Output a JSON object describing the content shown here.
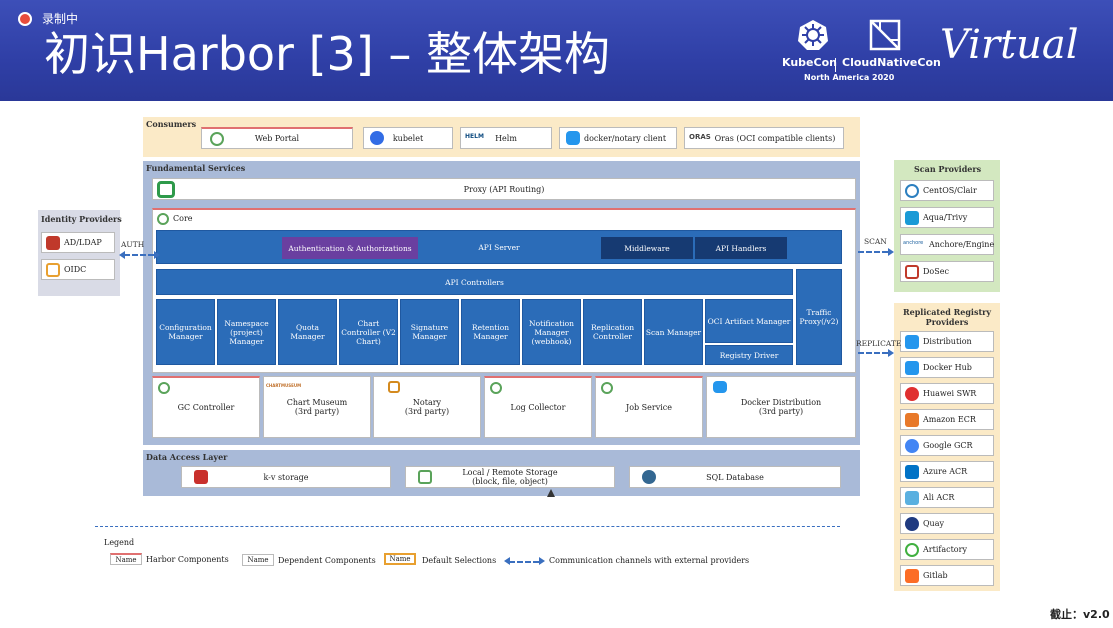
{
  "recording": {
    "label": "录制中"
  },
  "slide": {
    "title": "初识Harbor [3] – 整体架构"
  },
  "branding": {
    "kubecon": "KubeCon",
    "cloudnativecon": "CloudNativeCon",
    "event": "North America 2020",
    "virtual": "Virtual"
  },
  "consumers": {
    "title": "Consumers",
    "items": [
      "Web Portal",
      "kubelet",
      "Helm",
      "docker/notary client",
      "Oras (OCI compatible clients)"
    ],
    "helm_icon_text": "HELM",
    "oras_icon_text": "ORAS"
  },
  "fundamental": {
    "title": "Fundamental Services",
    "proxy": "Proxy (API Routing)",
    "core": "Core",
    "auth": "Authentication & Authorizations",
    "api_server": "API Server",
    "middleware": "Middleware",
    "api_handlers": "API Handlers",
    "api_controllers": "API Controllers",
    "controllers": [
      "Configuration Manager",
      "Namespace (project) Manager",
      "Quota Manager",
      "Chart Controller (V2 Chart)",
      "Signature Manager",
      "Retention Manager",
      "Notification Manager (webhook)",
      "Replication Controller",
      "Scan Manager"
    ],
    "oci_artifact": "OCI Artifact Manager",
    "registry_driver": "Registry Driver",
    "traffic_proxy": "Traffic Proxy(/v2)",
    "gc_controller": "GC Controller",
    "chart_museum": "Chart Museum",
    "chart_museum_sub": "(3rd party)",
    "chartmuseum_logo": "CHARTMUSEUM",
    "notary": "Notary",
    "notary_sub": "(3rd party)",
    "log_collector": "Log Collector",
    "job_service": "Job Service",
    "docker_distribution": "Docker Distribution",
    "docker_distribution_sub": "(3rd party)"
  },
  "data_access": {
    "title": "Data Access Layer",
    "kv": "k-v storage",
    "storage": "Local / Remote Storage",
    "storage_sub": "(block, file, object)",
    "sql": "SQL Database"
  },
  "identity": {
    "title": "Identity Providers",
    "items": [
      "AD/LDAP",
      "OIDC"
    ],
    "auth_label": "AUTH"
  },
  "scan": {
    "title": "Scan Providers",
    "items": [
      "CentOS/Clair",
      "Aqua/Trivy",
      "Anchore/Engine",
      "DoSec"
    ],
    "label": "SCAN",
    "anchore_icon_text": "anchore"
  },
  "replication": {
    "title": "Replicated Registry Providers",
    "items": [
      "Distribution",
      "Docker Hub",
      "Huawei SWR",
      "Amazon ECR",
      "Google GCR",
      "Azure ACR",
      "Ali ACR",
      "Quay",
      "Artifactory",
      "Gitlab"
    ],
    "label": "REPLICATE"
  },
  "legend": {
    "title": "Legend",
    "box_label": "Name",
    "harbor": "Harbor Components",
    "dependent": "Dependent Components",
    "default": "Default Selections",
    "channels": "Communication channels with external providers"
  },
  "footer": {
    "version": "截止：v2.0"
  },
  "colors": {
    "banner": "#2f3fa6",
    "blue": "#2b6cb8",
    "navy": "#163a72",
    "purple": "#6a3fa0",
    "consumers_bg": "#fbeac7",
    "fundamental_bg": "#a9bad8",
    "scan_bg": "#d3e8c0"
  }
}
